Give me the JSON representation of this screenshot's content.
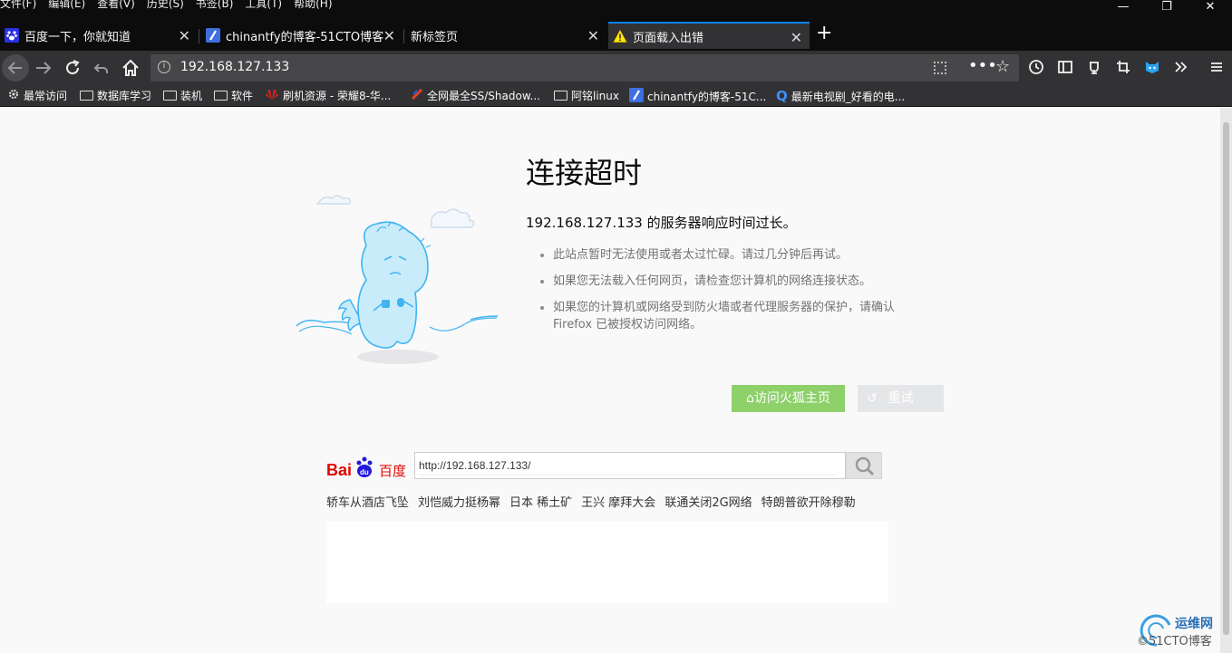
{
  "menubar": {
    "items": [
      "文件(F)",
      "编辑(E)",
      "查看(V)",
      "历史(S)",
      "书签(B)",
      "工具(T)",
      "帮助(H)"
    ],
    "min": "—",
    "max": "❐",
    "close": "✕"
  },
  "tabs": [
    {
      "title": "百度一下，你就知道"
    },
    {
      "title": "chinantfy的博客-51CTO博客"
    },
    {
      "title": "新标签页"
    },
    {
      "title": "页面载入出错"
    }
  ],
  "newtab_label": "+",
  "urlbar": {
    "url": "192.168.127.133"
  },
  "bookmarks": [
    {
      "label": "最常访问"
    },
    {
      "label": "数据库学习"
    },
    {
      "label": "装机"
    },
    {
      "label": "软件"
    },
    {
      "label": "刷机资源 - 荣耀8-华..."
    },
    {
      "label": "全网最全SS/Shadow..."
    },
    {
      "label": "阿铭linux"
    },
    {
      "label": "chinantfy的博客-51C..."
    },
    {
      "label": "最新电视剧_好看的电..."
    }
  ],
  "error": {
    "title": "连接超时",
    "description": "192.168.127.133 的服务器响应时间过长。",
    "items": [
      "此站点暂时无法使用或者太过忙碌。请过几分钟后再试。",
      "如果您无法载入任何网页，请检查您计算机的网络连接状态。",
      "如果您的计算机或网络受到防火墙或者代理服务器的保护，请确认 Firefox 已被授权访问网络。"
    ],
    "home_button": "访问火狐主页",
    "retry_button": "重试"
  },
  "baidu": {
    "logo_text": "Bai 百度",
    "search_value": "http://192.168.127.133/",
    "hot": [
      "轿车从酒店飞坠",
      "刘恺威力挺杨幂",
      "日本 稀土矿",
      "王兴 摩拜大会",
      "联通关闭2G网络",
      "特朗普欲开除穆勒"
    ]
  },
  "watermark": {
    "line1": "运维网",
    "line2": "©51CTO博客"
  },
  "colors": {
    "accent": "#0a84ff",
    "home_button": "#8ed16b",
    "retry_button": "#e5e6e8"
  }
}
